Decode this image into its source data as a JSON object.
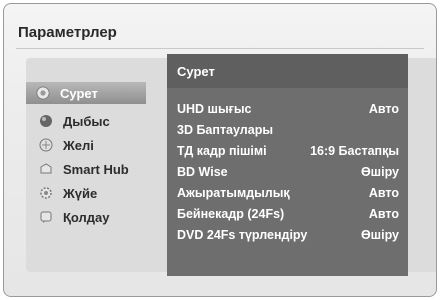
{
  "page_title": "Параметрлер",
  "menu": {
    "items": [
      {
        "label": "Сурет",
        "icon": "picture-icon",
        "active": true
      },
      {
        "label": "Дыбыс",
        "icon": "sound-icon",
        "active": false
      },
      {
        "label": "Желі",
        "icon": "network-icon",
        "active": false
      },
      {
        "label": "Smart Hub",
        "icon": "smart-hub-icon",
        "active": false
      },
      {
        "label": "Жүйе",
        "icon": "gear-icon",
        "active": false
      },
      {
        "label": "Қолдау",
        "icon": "support-icon",
        "active": false
      }
    ]
  },
  "submenu": {
    "title": "Сурет",
    "rows": [
      {
        "label": "UHD шығыс",
        "value": "Авто"
      },
      {
        "label": "3D Баптаулары",
        "value": ""
      },
      {
        "label": "ТД кадр пішімі",
        "value": "16:9 Бастапқы"
      },
      {
        "label": "BD Wise",
        "value": "Өшіру"
      },
      {
        "label": "Ажыратымдылық",
        "value": "Авто"
      },
      {
        "label": "Бейнекадр (24Fs)",
        "value": "Авто"
      },
      {
        "label": "DVD 24Fs түрлендіру",
        "value": "Өшіру"
      }
    ]
  }
}
